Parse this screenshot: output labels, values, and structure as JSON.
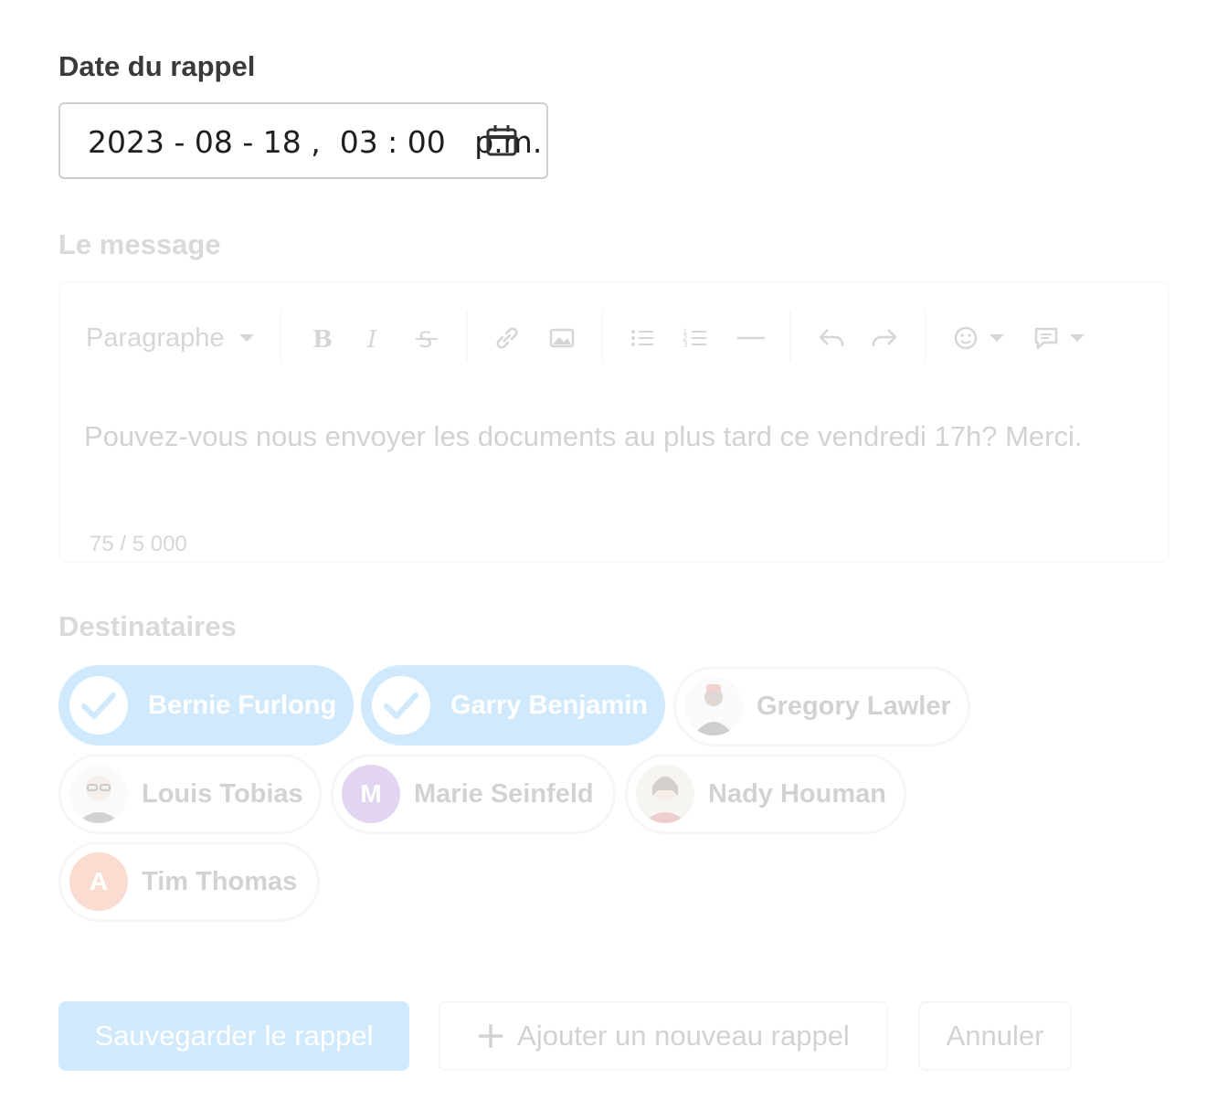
{
  "reminder_date": {
    "label": "Date du rappel",
    "value": "2023 - 08 - 18 ,  03 : 00   p.m."
  },
  "message": {
    "label": "Le message",
    "toolbar": {
      "paragraph_label": "Paragraphe"
    },
    "text": "Pouvez-vous nous envoyer les documents au plus tard ce vendredi 17h? Merci.",
    "counter": "75 / 5 000"
  },
  "recipients": {
    "label": "Destinataires",
    "items": [
      {
        "name": "Bernie Furlong",
        "selected": true
      },
      {
        "name": "Garry Benjamin",
        "selected": true
      },
      {
        "name": "Gregory Lawler",
        "selected": false
      },
      {
        "name": "Louis Tobias",
        "selected": false
      },
      {
        "name": "Marie Seinfeld",
        "selected": false,
        "initial": "M",
        "color": "#7d3fc0"
      },
      {
        "name": "Nady Houman",
        "selected": false
      },
      {
        "name": "Tim Thomas",
        "selected": false,
        "initial": "A",
        "color": "#e8622a"
      }
    ]
  },
  "actions": {
    "save_label": "Sauvegarder le rappel",
    "add_label": "Ajouter un nouveau rappel",
    "cancel_label": "Annuler"
  },
  "colors": {
    "accent": "#2e9df0"
  }
}
